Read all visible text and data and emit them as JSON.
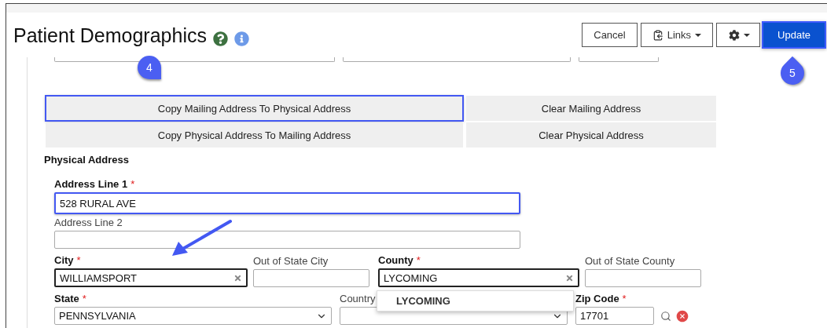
{
  "header": {
    "title": "Patient Demographics",
    "buttons": [
      {
        "kind": "plain",
        "label": "Cancel",
        "highlighted": false
      },
      {
        "kind": "links",
        "label": "Links",
        "highlighted": false
      },
      {
        "kind": "settings",
        "highlighted": false
      },
      {
        "kind": "primary",
        "label": "Update",
        "highlighted": true
      }
    ]
  },
  "annotations": [
    {
      "label": "4"
    },
    {
      "label": "5"
    }
  ],
  "address_actions": [
    {
      "label": "Copy Mailing Address To Physical Address",
      "highlighted": true
    },
    {
      "label": "Clear Mailing Address",
      "highlighted": false
    },
    {
      "label": "Copy Physical Address To Mailing Address",
      "highlighted": false
    },
    {
      "label": "Clear Physical Address",
      "highlighted": false
    }
  ],
  "section_title": "Physical Address",
  "field_rows": [
    [
      {
        "kind": "text",
        "label": "Address Line 1",
        "required_mark": "*",
        "value": "528 RURAL AVE",
        "highlighted": true,
        "focused": false
      }
    ],
    [
      {
        "kind": "text",
        "label": "Address Line 2",
        "highlighted": false,
        "focused": false
      }
    ],
    [
      {
        "kind": "clearable",
        "label": "City",
        "required_mark": "*",
        "value": "WILLIAMSPORT",
        "highlighted": false,
        "focused": true
      },
      {
        "kind": "text",
        "label": "Out of State City",
        "highlighted": false,
        "focused": false
      },
      {
        "kind": "clearable",
        "label": "County",
        "required_mark": "*",
        "value": "LYCOMING",
        "highlighted": false,
        "focused": true,
        "suggestions": [
          "LYCOMING"
        ]
      },
      {
        "kind": "text",
        "label": "Out of State County",
        "highlighted": false,
        "focused": false
      }
    ],
    [
      {
        "kind": "select",
        "label": "State",
        "required_mark": "*",
        "value": "PENNSYLVANIA",
        "highlighted": false,
        "focused": false
      },
      {
        "kind": "select",
        "label": "Country",
        "highlighted": false,
        "focused": false
      },
      {
        "kind": "zip",
        "label": "Zip Code",
        "required_mark": "*",
        "value": "17701",
        "highlighted": false,
        "focused": false
      }
    ]
  ]
}
